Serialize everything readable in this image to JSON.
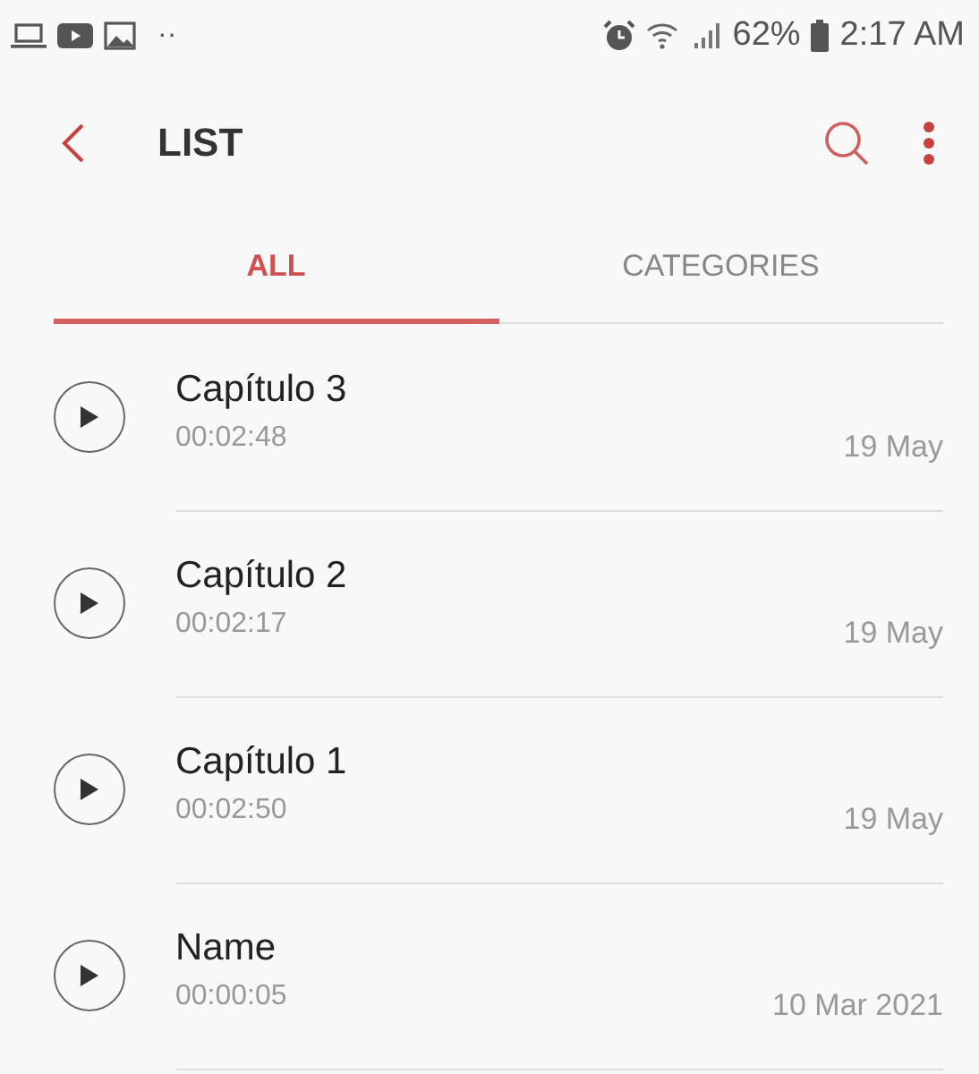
{
  "status_bar": {
    "battery": "62%",
    "time": "2:17 AM",
    "dots": "··"
  },
  "toolbar": {
    "title": "LIST"
  },
  "tabs": [
    {
      "label": "ALL",
      "selected": true
    },
    {
      "label": "CATEGORIES",
      "selected": false
    }
  ],
  "recordings": [
    {
      "name": "Capítulo 3",
      "duration": "00:02:48",
      "date": "19 May"
    },
    {
      "name": "Capítulo 2",
      "duration": "00:02:17",
      "date": "19 May"
    },
    {
      "name": "Capítulo 1",
      "duration": "00:02:50",
      "date": "19 May"
    },
    {
      "name": "Name",
      "duration": "00:00:05",
      "date": "10 Mar 2021"
    }
  ]
}
